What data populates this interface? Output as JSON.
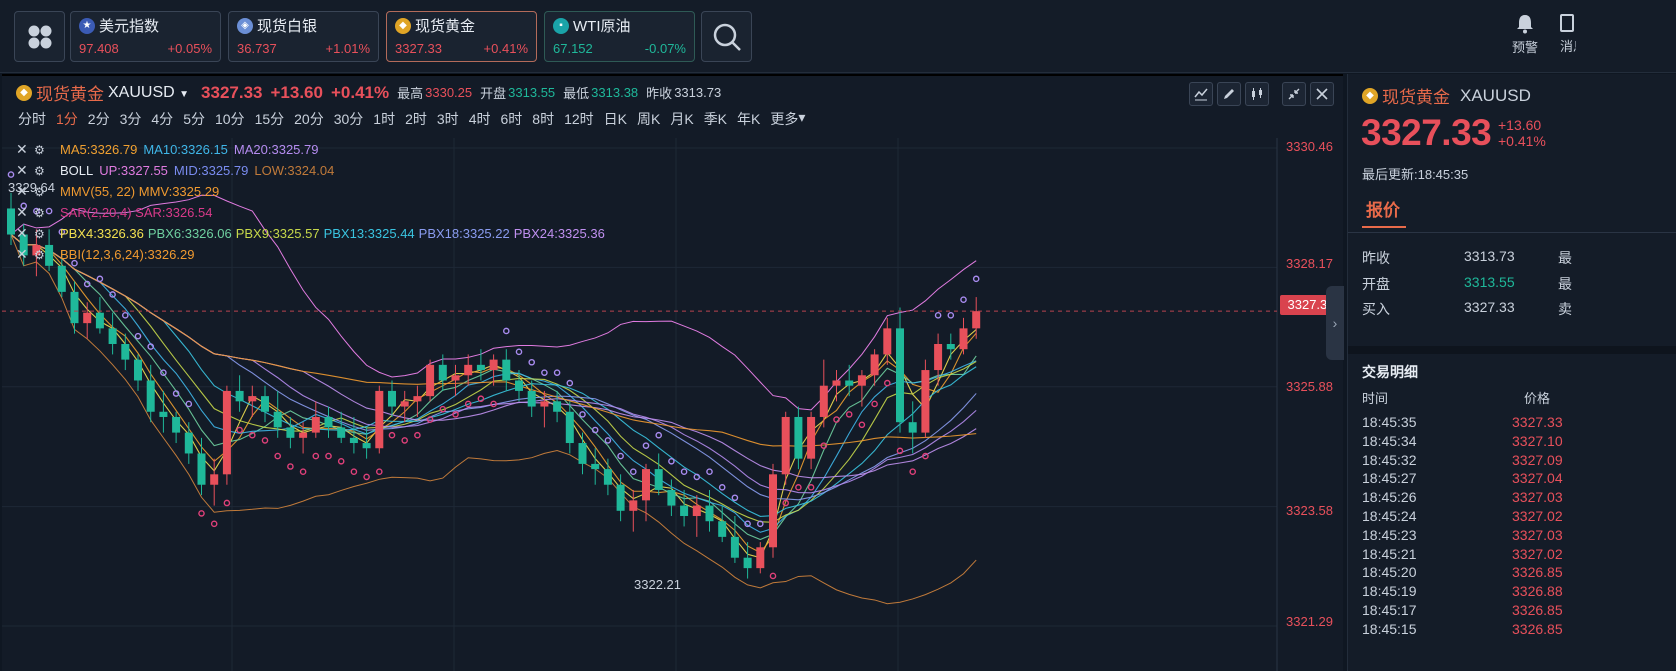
{
  "tickers": [
    {
      "name": "美元指数",
      "price": "97.408",
      "change": "+0.05%",
      "icon": "us-flag-icon"
    },
    {
      "name": "现货白银",
      "price": "36.737",
      "change": "+1.01%",
      "icon": "silver-icon"
    },
    {
      "name": "现货黄金",
      "price": "3327.33",
      "change": "+0.41%",
      "icon": "gold-icon"
    },
    {
      "name": "WTI原油",
      "price": "67.152",
      "change": "-0.07%",
      "icon": "oil-icon"
    }
  ],
  "toolbar": {
    "alert_label": "预警",
    "more_label": "消息"
  },
  "chart": {
    "name": "现货黄金",
    "code": "XAUUSD",
    "price": "3327.33",
    "change": "+13.60",
    "change_pct": "+0.41%",
    "high_label": "最高",
    "high": "3330.25",
    "open_label": "开盘",
    "open": "3313.55",
    "low_label": "最低",
    "low": "3313.38",
    "prev_label": "昨收",
    "prev": "3313.73"
  },
  "periods": [
    "分时",
    "1分",
    "2分",
    "3分",
    "4分",
    "5分",
    "10分",
    "15分",
    "20分",
    "30分",
    "1时",
    "2时",
    "3时",
    "4时",
    "6时",
    "8时",
    "12时",
    "日K",
    "周K",
    "月K",
    "季K",
    "年K",
    "更多"
  ],
  "indicators": {
    "ma5": "MA5:3326.79",
    "ma10": "MA10:3326.15",
    "ma20": "MA20:3325.79",
    "boll": "BOLL",
    "boll_up": "UP:3327.55",
    "boll_mid": "MID:3325.79",
    "boll_low": "LOW:3324.04",
    "mmv": "MMV(55, 22) MMV:3325.29",
    "sar": "SAR(2,20,4) SAR:3326.54",
    "pbx4": "PBX4:3326.36",
    "pbx6": "PBX6:3326.06",
    "pbx9": "PBX9:3325.57",
    "pbx13": "PBX13:3325.44",
    "pbx18": "PBX18:3325.22",
    "pbx24": "PBX24:3325.36",
    "bbi": "BBI(12,3,6,24):3326.29"
  },
  "axis": [
    "3330.46",
    "3328.17",
    "3325.88",
    "3323.58",
    "3321.29"
  ],
  "current_price_tag": "3327.33",
  "low_mark": "3322.21",
  "high_mark": "3329.64",
  "colors": {
    "up": "#e8505b",
    "down": "#1fb89a",
    "accent": "#e86a4a"
  },
  "chart_data": {
    "type": "candlestick",
    "y_axis_ticks": [
      3330.46,
      3328.17,
      3325.88,
      3323.58,
      3321.29
    ],
    "candles": [
      [
        3329.3,
        3329.6,
        3328.6,
        3328.8
      ],
      [
        3328.8,
        3329.0,
        3328.2,
        3328.4
      ],
      [
        3328.4,
        3328.9,
        3328.0,
        3328.6
      ],
      [
        3328.6,
        3328.9,
        3328.1,
        3328.2
      ],
      [
        3328.2,
        3328.5,
        3327.6,
        3327.7
      ],
      [
        3327.7,
        3327.9,
        3326.9,
        3327.1
      ],
      [
        3327.1,
        3327.5,
        3326.8,
        3327.3
      ],
      [
        3327.3,
        3327.6,
        3326.9,
        3327.0
      ],
      [
        3327.0,
        3327.3,
        3326.5,
        3326.7
      ],
      [
        3326.7,
        3326.9,
        3326.2,
        3326.4
      ],
      [
        3326.4,
        3326.5,
        3325.8,
        3326.0
      ],
      [
        3326.0,
        3326.3,
        3325.2,
        3325.4
      ],
      [
        3325.4,
        3325.8,
        3325.0,
        3325.3
      ],
      [
        3325.3,
        3325.4,
        3324.8,
        3325.0
      ],
      [
        3325.0,
        3325.2,
        3324.4,
        3324.6
      ],
      [
        3324.6,
        3324.9,
        3323.8,
        3324.0
      ],
      [
        3324.0,
        3324.5,
        3323.6,
        3324.2
      ],
      [
        3324.2,
        3325.9,
        3324.0,
        3325.8
      ],
      [
        3325.8,
        3326.1,
        3325.4,
        3325.6
      ],
      [
        3325.6,
        3325.9,
        3325.3,
        3325.7
      ],
      [
        3325.7,
        3325.9,
        3325.2,
        3325.4
      ],
      [
        3325.4,
        3325.8,
        3324.9,
        3325.1
      ],
      [
        3325.1,
        3325.3,
        3324.7,
        3324.9
      ],
      [
        3324.9,
        3325.2,
        3324.6,
        3325.0
      ],
      [
        3325.0,
        3325.6,
        3324.9,
        3325.3
      ],
      [
        3325.3,
        3325.5,
        3324.9,
        3325.1
      ],
      [
        3325.1,
        3325.4,
        3324.8,
        3324.9
      ],
      [
        3324.9,
        3325.3,
        3324.6,
        3324.8
      ],
      [
        3324.8,
        3325.1,
        3324.5,
        3324.7
      ],
      [
        3324.7,
        3325.9,
        3324.6,
        3325.8
      ],
      [
        3325.8,
        3326.0,
        3325.3,
        3325.5
      ],
      [
        3325.5,
        3325.8,
        3325.2,
        3325.6
      ],
      [
        3325.6,
        3325.9,
        3325.3,
        3325.7
      ],
      [
        3325.7,
        3326.4,
        3325.6,
        3326.3
      ],
      [
        3326.3,
        3326.5,
        3325.8,
        3326.0
      ],
      [
        3326.0,
        3326.3,
        3325.7,
        3326.1
      ],
      [
        3326.1,
        3326.5,
        3325.9,
        3326.3
      ],
      [
        3326.3,
        3326.6,
        3326.0,
        3326.2
      ],
      [
        3326.2,
        3326.5,
        3325.9,
        3326.4
      ],
      [
        3326.4,
        3326.6,
        3325.8,
        3326.0
      ],
      [
        3326.0,
        3326.2,
        3325.6,
        3325.8
      ],
      [
        3325.8,
        3326.0,
        3325.3,
        3325.5
      ],
      [
        3325.5,
        3325.8,
        3325.1,
        3325.6
      ],
      [
        3325.6,
        3325.8,
        3325.2,
        3325.4
      ],
      [
        3325.4,
        3325.6,
        3324.6,
        3324.8
      ],
      [
        3324.8,
        3325.0,
        3324.2,
        3324.4
      ],
      [
        3324.4,
        3324.7,
        3324.0,
        3324.3
      ],
      [
        3324.3,
        3324.5,
        3323.8,
        3324.0
      ],
      [
        3324.0,
        3324.2,
        3323.3,
        3323.5
      ],
      [
        3323.5,
        3323.9,
        3323.1,
        3323.7
      ],
      [
        3323.7,
        3324.4,
        3323.3,
        3324.3
      ],
      [
        3324.3,
        3324.6,
        3323.8,
        3323.9
      ],
      [
        3323.9,
        3324.1,
        3323.4,
        3323.6
      ],
      [
        3323.6,
        3323.9,
        3323.2,
        3323.4
      ],
      [
        3323.4,
        3323.8,
        3323.0,
        3323.6
      ],
      [
        3323.6,
        3323.9,
        3323.1,
        3323.3
      ],
      [
        3323.3,
        3323.6,
        3322.9,
        3323.0
      ],
      [
        3323.0,
        3323.4,
        3322.5,
        3322.6
      ],
      [
        3322.6,
        3322.9,
        3322.2,
        3322.4
      ],
      [
        3322.4,
        3322.9,
        3322.3,
        3322.8
      ],
      [
        3322.8,
        3324.4,
        3322.6,
        3324.2
      ],
      [
        3324.2,
        3325.4,
        3324.0,
        3325.3
      ],
      [
        3325.3,
        3325.5,
        3324.3,
        3324.5
      ],
      [
        3324.5,
        3325.4,
        3324.3,
        3325.3
      ],
      [
        3325.3,
        3326.4,
        3325.1,
        3325.9
      ],
      [
        3325.9,
        3326.2,
        3325.6,
        3326.0
      ],
      [
        3326.0,
        3326.3,
        3325.7,
        3325.9
      ],
      [
        3325.9,
        3326.2,
        3325.5,
        3326.1
      ],
      [
        3326.1,
        3326.6,
        3325.9,
        3326.5
      ],
      [
        3326.5,
        3327.2,
        3326.3,
        3327.0
      ],
      [
        3327.0,
        3327.4,
        3325.0,
        3325.2
      ],
      [
        3325.2,
        3325.6,
        3324.6,
        3325.0
      ],
      [
        3325.0,
        3326.4,
        3324.9,
        3326.2
      ],
      [
        3326.2,
        3326.9,
        3325.9,
        3326.7
      ],
      [
        3326.7,
        3326.9,
        3326.4,
        3326.6
      ],
      [
        3326.6,
        3327.2,
        3326.5,
        3327.0
      ],
      [
        3327.0,
        3327.6,
        3326.8,
        3327.33
      ]
    ]
  },
  "quote": {
    "tab": "报价",
    "updated": "最后更新:18:45:35",
    "rows": [
      {
        "label": "昨收",
        "value": "3313.73",
        "cut": "最"
      },
      {
        "label": "开盘",
        "value": "3313.55",
        "cut": "最"
      },
      {
        "label": "买入",
        "value": "3327.33",
        "cut": "卖"
      }
    ]
  },
  "deals": {
    "title": "交易明细",
    "time_header": "时间",
    "price_header": "价格",
    "rows": [
      {
        "time": "18:45:35",
        "price": "3327.33"
      },
      {
        "time": "18:45:34",
        "price": "3327.10"
      },
      {
        "time": "18:45:32",
        "price": "3327.09"
      },
      {
        "time": "18:45:27",
        "price": "3327.04"
      },
      {
        "time": "18:45:26",
        "price": "3327.03"
      },
      {
        "time": "18:45:24",
        "price": "3327.02"
      },
      {
        "time": "18:45:23",
        "price": "3327.03"
      },
      {
        "time": "18:45:21",
        "price": "3327.02"
      },
      {
        "time": "18:45:20",
        "price": "3326.85"
      },
      {
        "time": "18:45:19",
        "price": "3326.88"
      },
      {
        "time": "18:45:17",
        "price": "3326.85"
      },
      {
        "time": "18:45:15",
        "price": "3326.85"
      }
    ]
  }
}
